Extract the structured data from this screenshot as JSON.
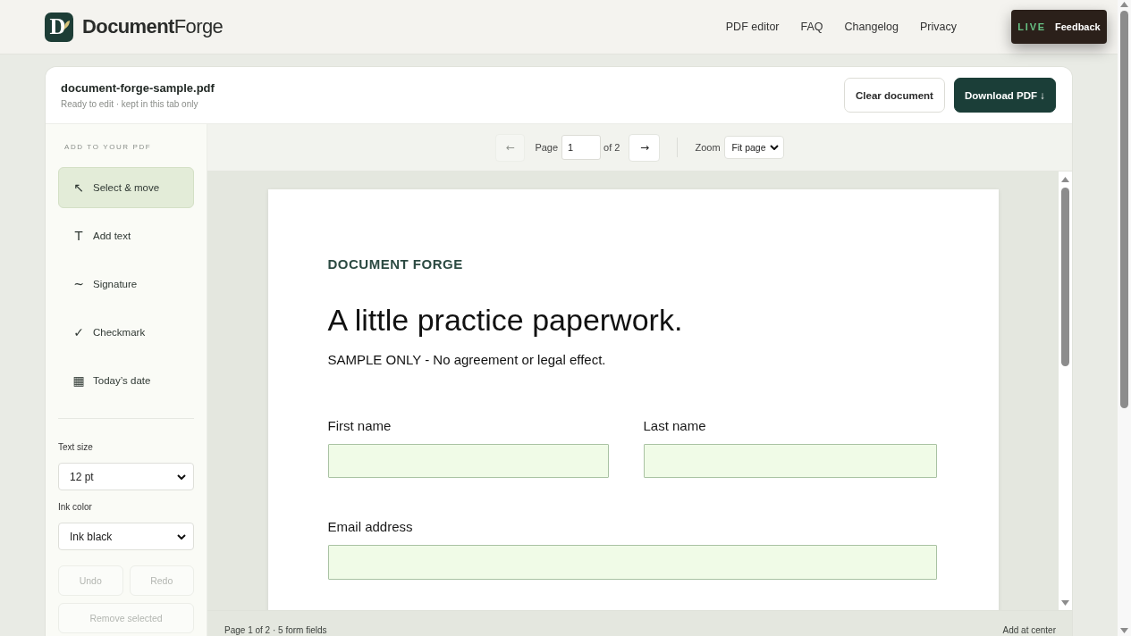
{
  "header": {
    "logo_mark": "D",
    "brand": "**Document**Forge",
    "nav": [
      {
        "label": "PDF editor"
      },
      {
        "label": "FAQ"
      },
      {
        "label": "Changelog"
      },
      {
        "label": "Privacy"
      }
    ],
    "feedback": {
      "badge": "LIVE",
      "label": "Feedback"
    }
  },
  "file_bar": {
    "filename": "document-forge-sample.pdf",
    "status": "Ready to edit · kept in this tab only",
    "buttons": [
      {
        "label": "Clear document",
        "kind": "secondary"
      },
      {
        "label": "Download PDF ↓",
        "kind": "primary"
      }
    ]
  },
  "sidebar": {
    "heading": "ADD TO YOUR PDF",
    "tools": [
      {
        "icon": "↖",
        "label": "Select & move",
        "selected": true
      },
      {
        "icon": "T",
        "label": "Add text",
        "selected": false
      },
      {
        "icon": "~",
        "label": "Signature",
        "selected": false
      },
      {
        "icon": "✓",
        "label": "Checkmark",
        "selected": false
      },
      {
        "icon": "▦",
        "label": "Today’s date",
        "selected": false
      }
    ],
    "settings": [
      {
        "label": "Text size",
        "value": "12 pt"
      },
      {
        "label": "Ink color",
        "value": "Ink black"
      }
    ],
    "actions": [
      {
        "label": "Undo",
        "disabled": true
      },
      {
        "label": "Redo",
        "disabled": true
      },
      {
        "label": "Remove selected",
        "disabled": true
      }
    ]
  },
  "toolbar": {
    "prev": {
      "icon": "←",
      "disabled": true
    },
    "page_label": "Page",
    "page_value": "1",
    "page_total": "of 2",
    "next": {
      "icon": "→",
      "disabled": false
    },
    "zoom_label": "Zoom",
    "zoom_value": "Fit page"
  },
  "document": {
    "brand": "DOCUMENT FORGE",
    "title": "A little practice paperwork.",
    "notice": "SAMPLE ONLY - No agreement or legal effect.",
    "fields": [
      {
        "label": "First name",
        "kind": "half"
      },
      {
        "label": "Last name",
        "kind": "half"
      },
      {
        "label": "Email address",
        "kind": "full"
      }
    ]
  },
  "status_bar": {
    "summary": "Page 1 of 2 · 5 form fields",
    "hint": "Add at center"
  }
}
